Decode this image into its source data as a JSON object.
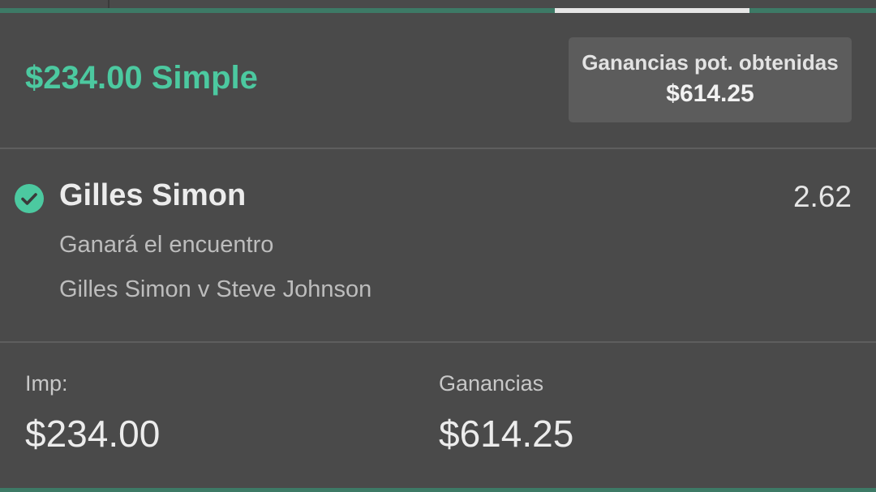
{
  "colors": {
    "background": "#4a4a4a",
    "accent_green": "#4cc9a0",
    "tab_green": "#3d7a66",
    "panel": "#5c5c5c"
  },
  "bet": {
    "title": "$234.00 Simple",
    "potential_label": "Ganancias pot. obtenidas",
    "potential_value": "$614.25"
  },
  "selection": {
    "status_icon": "check-circle-icon",
    "name": "Gilles Simon",
    "odds": "2.62",
    "market": "Ganará el encuentro",
    "event": "Gilles Simon v Steve Johnson"
  },
  "summary": {
    "stake_label": "Imp:",
    "stake_value": "$234.00",
    "returns_label": "Ganancias",
    "returns_value": "$614.25"
  }
}
